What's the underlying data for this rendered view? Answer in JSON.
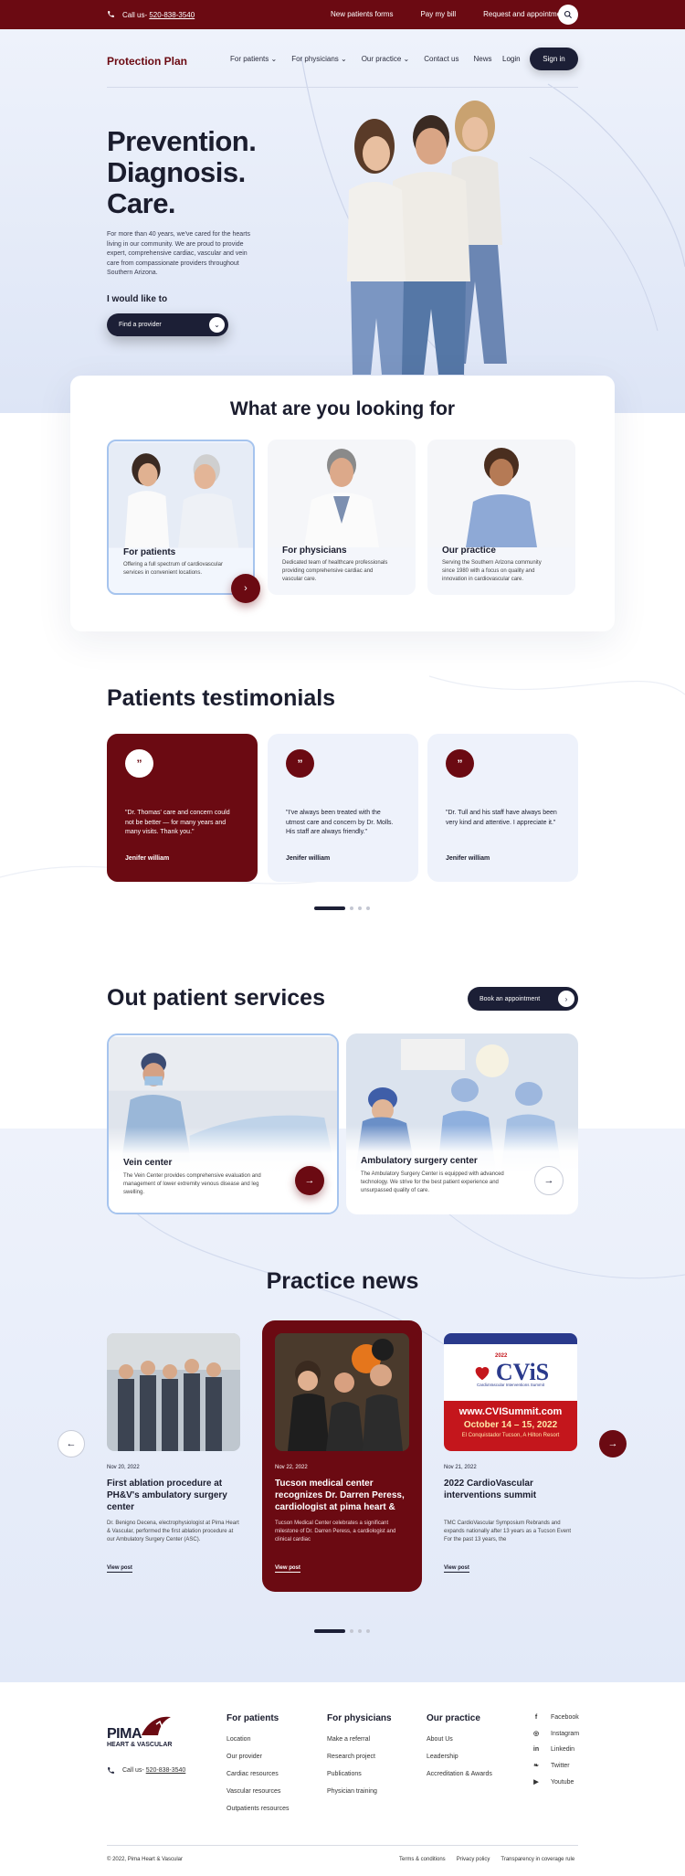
{
  "topbar": {
    "phone_label": "Call us- ",
    "phone_number": "520-838-3540",
    "links": [
      "New patients forms",
      "Pay my bill",
      "Request and appointment"
    ]
  },
  "nav": {
    "brand": "Protection Plan",
    "menu": [
      "For patients",
      "For physicians",
      "Our practice",
      "Contact us",
      "News"
    ],
    "login": "Login",
    "signin": "Sign in"
  },
  "hero": {
    "title_lines": [
      "Prevention.",
      "Diagnosis.",
      "Care."
    ],
    "paragraph": "For more than 40 years, we've cared for the hearts living in our community. We are proud to provide expert, comprehensive cardiac, vascular and vein care from compassionate providers throughout Southern Arizona.",
    "would_like": "I would like to",
    "select_value": "Find a provider"
  },
  "looking": {
    "title": "What are you looking for",
    "cards": [
      {
        "title": "For patients",
        "desc": "Offering a full spectrum of cardiovascular services in convenient locations."
      },
      {
        "title": "For physicians",
        "desc": "Dedicated team of healthcare professionals providing comprehensive cardiac and vascular care."
      },
      {
        "title": "Our practice",
        "desc": "Serving the Southern Arizona community since 1980 with a focus on quality and innovation in cardiovascular care."
      }
    ]
  },
  "testimonials": {
    "title": "Patients testimonials",
    "items": [
      {
        "quote": "\"Dr. Thomas' care and concern could not be better — for many years and many visits. Thank you.\"",
        "name": "Jenifer william"
      },
      {
        "quote": "\"I've always been treated with the utmost care and concern by Dr. Molls. His staff are always friendly.\"",
        "name": "Jenifer william"
      },
      {
        "quote": "\"Dr. Tull and his staff have always been very kind and attentive. I appreciate it.\"",
        "name": "Jenifer william"
      }
    ]
  },
  "services": {
    "title": "Out patient services",
    "book": "Book an appointment",
    "items": [
      {
        "title": "Vein center",
        "desc": "The Vein Center provides comprehensive evaluation and management of lower extremity venous disease and leg swelling."
      },
      {
        "title": "Ambulatory surgery center",
        "desc": "The Ambulatory Surgery Center is equipped with advanced technology. We strive for the best patient experience and unsurpassed quality of care."
      }
    ]
  },
  "news": {
    "title": "Practice news",
    "items": [
      {
        "date": "Nov 20, 2022",
        "title": "First ablation procedure at PH&V's ambulatory surgery center",
        "excerpt": "Dr. Benigno Decena, electrophysiologist at Pima Heart & Vascular, performed the first ablation procedure at our Ambulatory Surgery Center (ASC).",
        "link": "View post"
      },
      {
        "date": "Nov 22, 2022",
        "title": "Tucson medical center recognizes Dr. Darren Peress, cardiologist at pima heart &",
        "excerpt": "Tucson Medical Center celebrates a significant milestone of Dr. Darren Peress, a cardiologist and clinical cardiac",
        "link": "View post"
      },
      {
        "date": "Nov 21, 2022",
        "title": "2022 CardioVascular interventions summit",
        "excerpt": "TMC CardioVascular Symposium Rebrands and expands nationally after 13 years as a Tucson Event For the past 13 years, the",
        "link": "View post"
      }
    ],
    "cvis": {
      "year": "2022",
      "logo": "CViS",
      "subtitle": "CardioVascular Interventions Summit",
      "url": "www.CVISummit.com",
      "dates": "October 14 – 15, 2022",
      "venue": "El Conquistador Tucson, A Hilton Resort"
    }
  },
  "footer": {
    "logo_main": "PIMA",
    "logo_sub": "HEART & VASCULAR",
    "phone_label": "Call us- ",
    "phone_number": "520-838-3540",
    "cols": [
      {
        "title": "For patients",
        "items": [
          "Location",
          "Our provider",
          "Cardiac resources",
          "Vascular resources",
          "Outpatients resources"
        ]
      },
      {
        "title": "For physicians",
        "items": [
          "Make a referral",
          "Research project",
          "Publications",
          "Physician training"
        ]
      },
      {
        "title": "Our practice",
        "items": [
          "About Us",
          "Leadership",
          "Accreditation & Awards"
        ]
      }
    ],
    "social": [
      "Facebook",
      "Instagram",
      "Linkedin",
      "Twitter",
      "Youtube"
    ],
    "copyright": "© 2022, Pima Heart & Vascular",
    "bottom_links": [
      "Terms & conditions",
      "Privacy policy",
      "Transparency in coverage rule"
    ]
  },
  "colors": {
    "brand": "#6b0a12",
    "navy": "#1c1f36",
    "light": "#eef2fb"
  }
}
